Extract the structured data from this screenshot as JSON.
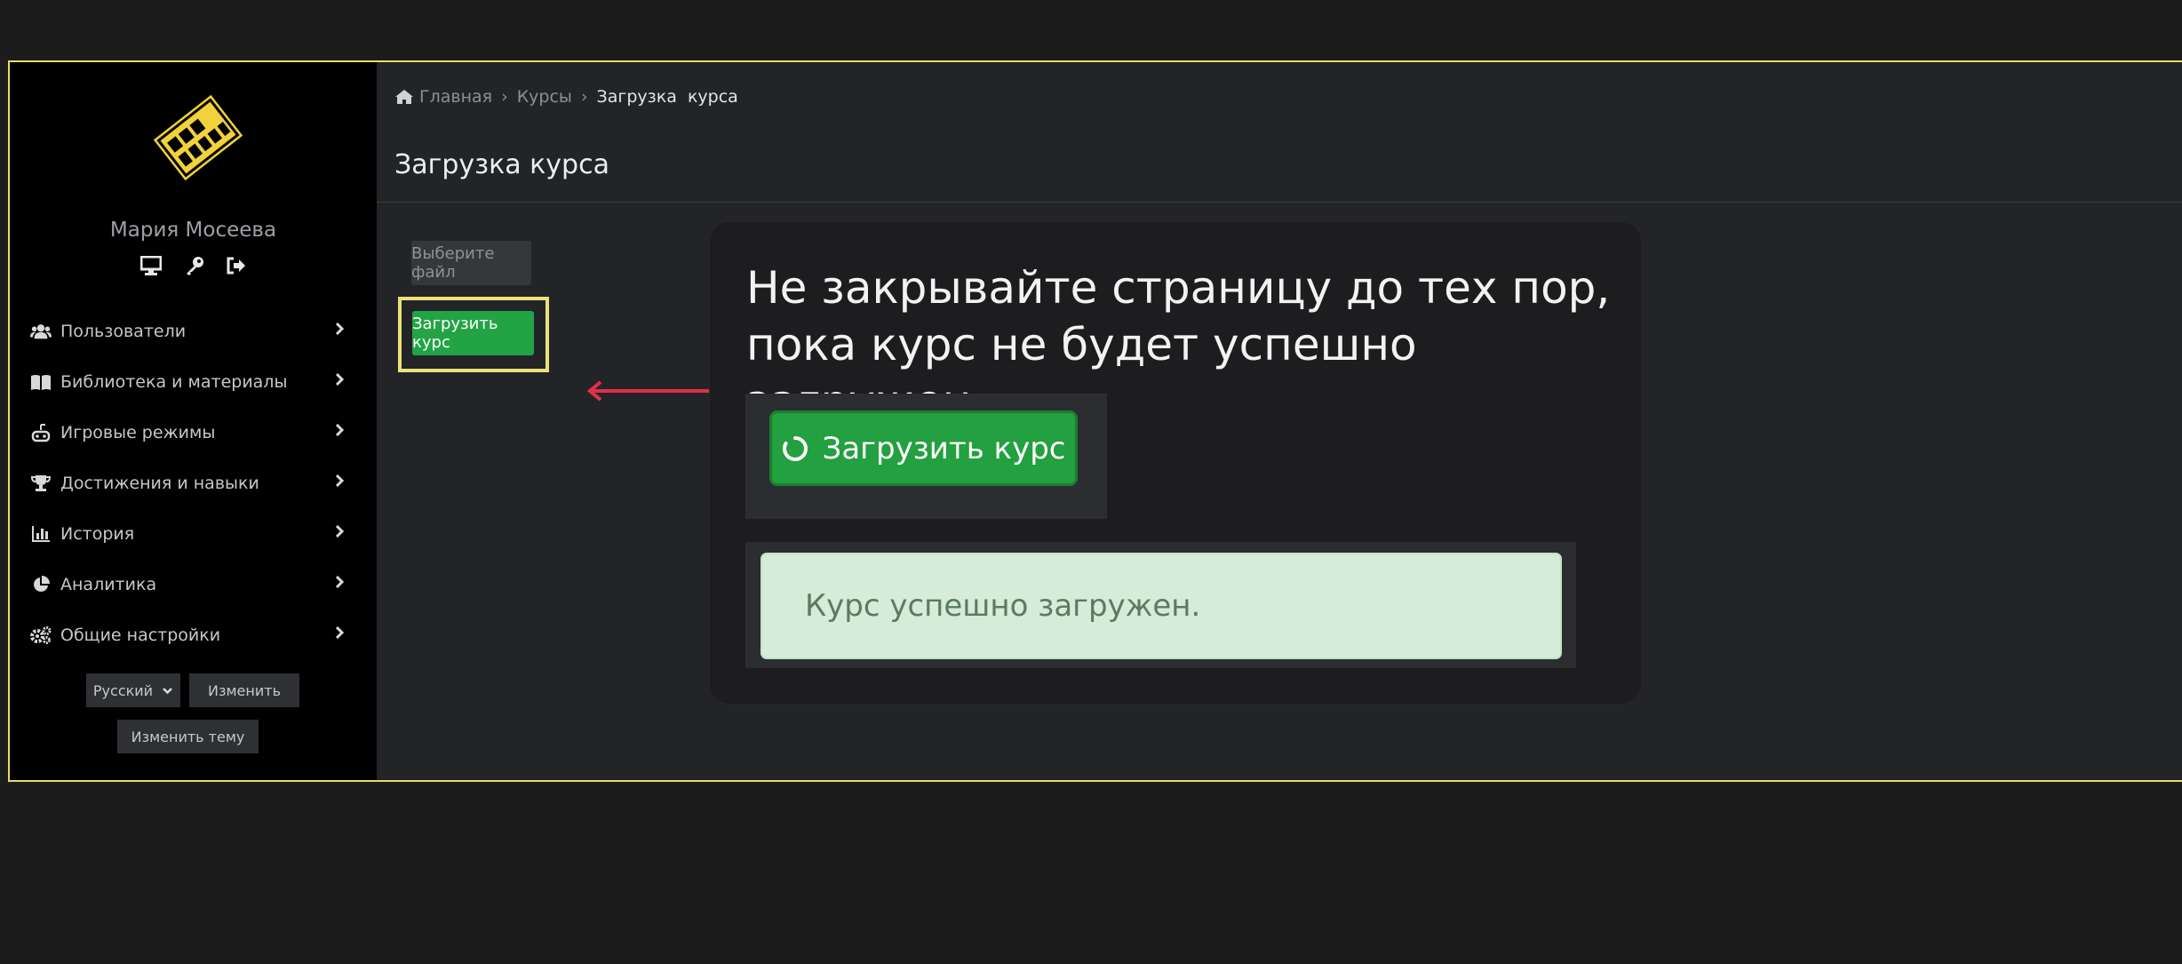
{
  "sidebar": {
    "user_name": "Мария Мосеева",
    "items": [
      {
        "label": "Пользователи",
        "icon": "users-icon"
      },
      {
        "label": "Библиотека и материалы",
        "icon": "book-icon"
      },
      {
        "label": "Игровые режимы",
        "icon": "gamepad-icon"
      },
      {
        "label": "Достижения и навыки",
        "icon": "trophy-icon"
      },
      {
        "label": "История",
        "icon": "bar-chart-icon"
      },
      {
        "label": "Аналитика",
        "icon": "pie-chart-icon"
      },
      {
        "label": "Общие настройки",
        "icon": "cogs-icon"
      }
    ],
    "language": "Русский",
    "change_label": "Изменить",
    "theme_label": "Изменить тему"
  },
  "breadcrumb": [
    "Главная",
    "Курсы",
    "Загрузка  курса"
  ],
  "page_title": "Загрузка курса",
  "file_button": "Выберите файл",
  "upload_button": "Загрузить курс",
  "callout": {
    "text_line1": "Не закрывайте страницу до тех пор,",
    "text_line2": "пока курс не будет успешно загружен.",
    "loading_button": "Загрузить курс",
    "success_message": "Курс успешно загружен."
  },
  "colors": {
    "accent_yellow": "#e8dc6a",
    "success_green": "#23a444",
    "arrow_red": "#e0304a"
  }
}
